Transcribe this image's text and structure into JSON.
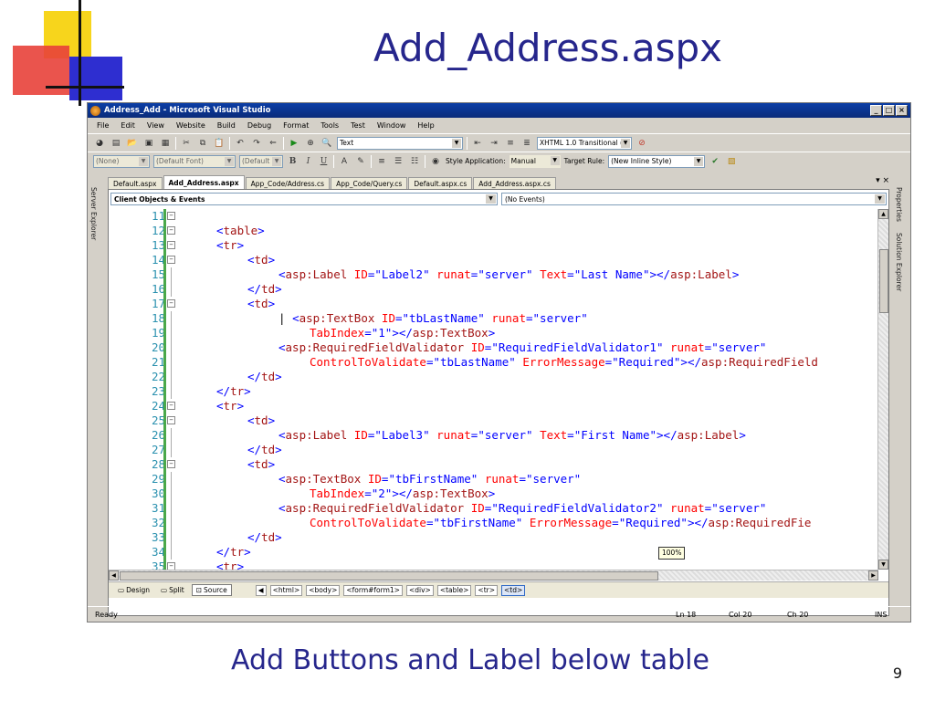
{
  "slide": {
    "title": "Add_Address.aspx",
    "subtitle": "Add Buttons and Label below table",
    "page_number": "9"
  },
  "window": {
    "title": "Address_Add - Microsoft Visual Studio",
    "controls": [
      "_",
      "□",
      "×"
    ]
  },
  "menu": [
    "File",
    "Edit",
    "View",
    "Website",
    "Build",
    "Debug",
    "Format",
    "Tools",
    "Test",
    "Window",
    "Help"
  ],
  "toolbar1": {
    "find_combo": "Text",
    "doctype_combo": "XHTML 1.0 Transitional ("
  },
  "toolbar2": {
    "block_format": "(None)",
    "font_name": "(Default Font)",
    "font_size": "(Default",
    "bold": "B",
    "italic": "I",
    "underline": "U",
    "style_application_label": "Style Application:",
    "style_application_value": "Manual",
    "target_rule_label": "Target Rule:",
    "target_rule_value": "(New Inline Style)"
  },
  "side_left": {
    "server_explorer": "Server Explorer"
  },
  "side_right": {
    "properties": "Properties",
    "solution_explorer": "Solution Explorer"
  },
  "doc_tabs": [
    "Default.aspx",
    "Add_Address.aspx",
    "App_Code/Address.cs",
    "App_Code/Query.cs",
    "Default.aspx.cs",
    "Add_Address.aspx.cs"
  ],
  "active_doc_tab": "Add_Address.aspx",
  "doc_tab_controls": "▾ ×",
  "nav": {
    "objects": "Client Objects & Events",
    "events": "(No Events)"
  },
  "code_lines": [
    {
      "n": "11",
      "indent": 0,
      "tokens": []
    },
    {
      "n": "12",
      "indent": 0,
      "tokens": [
        [
          "br",
          "<"
        ],
        [
          "tag",
          "table"
        ],
        [
          "br",
          ">"
        ]
      ]
    },
    {
      "n": "13",
      "indent": 0,
      "tokens": [
        [
          "br",
          "<"
        ],
        [
          "tag",
          "tr"
        ],
        [
          "br",
          ">"
        ]
      ]
    },
    {
      "n": "14",
      "indent": 1,
      "tokens": [
        [
          "br",
          "<"
        ],
        [
          "tag",
          "td"
        ],
        [
          "br",
          ">"
        ]
      ]
    },
    {
      "n": "15",
      "indent": 2,
      "tokens": [
        [
          "br",
          "<"
        ],
        [
          "tag",
          "asp:Label"
        ],
        [
          "t",
          " "
        ],
        [
          "attr",
          "ID"
        ],
        [
          "br",
          "="
        ],
        [
          "val",
          "\"Label2\""
        ],
        [
          "t",
          " "
        ],
        [
          "attr",
          "runat"
        ],
        [
          "br",
          "="
        ],
        [
          "val",
          "\"server\""
        ],
        [
          "t",
          " "
        ],
        [
          "attr",
          "Text"
        ],
        [
          "br",
          "="
        ],
        [
          "val",
          "\"Last Name\""
        ],
        [
          "br",
          "></"
        ],
        [
          "tag",
          "asp:Label"
        ],
        [
          "br",
          ">"
        ]
      ]
    },
    {
      "n": "16",
      "indent": 1,
      "tokens": [
        [
          "br",
          "</"
        ],
        [
          "tag",
          "td"
        ],
        [
          "br",
          ">"
        ]
      ]
    },
    {
      "n": "17",
      "indent": 1,
      "tokens": [
        [
          "br",
          "<"
        ],
        [
          "tag",
          "td"
        ],
        [
          "br",
          ">"
        ]
      ]
    },
    {
      "n": "18",
      "indent": 2,
      "tokens": [
        [
          "cur",
          "| "
        ],
        [
          "br",
          "<"
        ],
        [
          "tag",
          "asp:TextBox"
        ],
        [
          "t",
          " "
        ],
        [
          "attr",
          "ID"
        ],
        [
          "br",
          "="
        ],
        [
          "val",
          "\"tbLastName\""
        ],
        [
          "t",
          " "
        ],
        [
          "attr",
          "runat"
        ],
        [
          "br",
          "="
        ],
        [
          "val",
          "\"server\""
        ]
      ]
    },
    {
      "n": "19",
      "indent": 3,
      "tokens": [
        [
          "attr",
          "TabIndex"
        ],
        [
          "br",
          "="
        ],
        [
          "val",
          "\"1\""
        ],
        [
          "br",
          "></"
        ],
        [
          "tag",
          "asp:TextBox"
        ],
        [
          "br",
          ">"
        ]
      ]
    },
    {
      "n": "20",
      "indent": 2,
      "tokens": [
        [
          "br",
          "<"
        ],
        [
          "tag",
          "asp:RequiredFieldValidator"
        ],
        [
          "t",
          " "
        ],
        [
          "attr",
          "ID"
        ],
        [
          "br",
          "="
        ],
        [
          "val",
          "\"RequiredFieldValidator1\""
        ],
        [
          "t",
          " "
        ],
        [
          "attr",
          "runat"
        ],
        [
          "br",
          "="
        ],
        [
          "val",
          "\"server\""
        ]
      ]
    },
    {
      "n": "21",
      "indent": 3,
      "tokens": [
        [
          "attr",
          "ControlToValidate"
        ],
        [
          "br",
          "="
        ],
        [
          "val",
          "\"tbLastName\""
        ],
        [
          "t",
          " "
        ],
        [
          "attr",
          "ErrorMessage"
        ],
        [
          "br",
          "="
        ],
        [
          "val",
          "\"Required\""
        ],
        [
          "br",
          "></"
        ],
        [
          "tag",
          "asp:RequiredField"
        ]
      ]
    },
    {
      "n": "22",
      "indent": 1,
      "tokens": [
        [
          "br",
          "</"
        ],
        [
          "tag",
          "td"
        ],
        [
          "br",
          ">"
        ]
      ]
    },
    {
      "n": "23",
      "indent": 0,
      "tokens": [
        [
          "br",
          "</"
        ],
        [
          "tag",
          "tr"
        ],
        [
          "br",
          ">"
        ]
      ]
    },
    {
      "n": "24",
      "indent": 0,
      "tokens": [
        [
          "br",
          "<"
        ],
        [
          "tag",
          "tr"
        ],
        [
          "br",
          ">"
        ]
      ]
    },
    {
      "n": "25",
      "indent": 1,
      "tokens": [
        [
          "br",
          "<"
        ],
        [
          "tag",
          "td"
        ],
        [
          "br",
          ">"
        ]
      ]
    },
    {
      "n": "26",
      "indent": 2,
      "tokens": [
        [
          "br",
          "<"
        ],
        [
          "tag",
          "asp:Label"
        ],
        [
          "t",
          " "
        ],
        [
          "attr",
          "ID"
        ],
        [
          "br",
          "="
        ],
        [
          "val",
          "\"Label3\""
        ],
        [
          "t",
          " "
        ],
        [
          "attr",
          "runat"
        ],
        [
          "br",
          "="
        ],
        [
          "val",
          "\"server\""
        ],
        [
          "t",
          " "
        ],
        [
          "attr",
          "Text"
        ],
        [
          "br",
          "="
        ],
        [
          "val",
          "\"First Name\""
        ],
        [
          "br",
          "></"
        ],
        [
          "tag",
          "asp:Label"
        ],
        [
          "br",
          ">"
        ]
      ]
    },
    {
      "n": "27",
      "indent": 1,
      "tokens": [
        [
          "br",
          "</"
        ],
        [
          "tag",
          "td"
        ],
        [
          "br",
          ">"
        ]
      ]
    },
    {
      "n": "28",
      "indent": 1,
      "tokens": [
        [
          "br",
          "<"
        ],
        [
          "tag",
          "td"
        ],
        [
          "br",
          ">"
        ]
      ]
    },
    {
      "n": "29",
      "indent": 2,
      "tokens": [
        [
          "br",
          "<"
        ],
        [
          "tag",
          "asp:TextBox"
        ],
        [
          "t",
          " "
        ],
        [
          "attr",
          "ID"
        ],
        [
          "br",
          "="
        ],
        [
          "val",
          "\"tbFirstName\""
        ],
        [
          "t",
          " "
        ],
        [
          "attr",
          "runat"
        ],
        [
          "br",
          "="
        ],
        [
          "val",
          "\"server\""
        ]
      ]
    },
    {
      "n": "30",
      "indent": 3,
      "tokens": [
        [
          "attr",
          "TabIndex"
        ],
        [
          "br",
          "="
        ],
        [
          "val",
          "\"2\""
        ],
        [
          "br",
          "></"
        ],
        [
          "tag",
          "asp:TextBox"
        ],
        [
          "br",
          ">"
        ]
      ]
    },
    {
      "n": "31",
      "indent": 2,
      "tokens": [
        [
          "br",
          "<"
        ],
        [
          "tag",
          "asp:RequiredFieldValidator"
        ],
        [
          "t",
          " "
        ],
        [
          "attr",
          "ID"
        ],
        [
          "br",
          "="
        ],
        [
          "val",
          "\"RequiredFieldValidator2\""
        ],
        [
          "t",
          " "
        ],
        [
          "attr",
          "runat"
        ],
        [
          "br",
          "="
        ],
        [
          "val",
          "\"server\""
        ]
      ]
    },
    {
      "n": "32",
      "indent": 3,
      "tokens": [
        [
          "attr",
          "ControlToValidate"
        ],
        [
          "br",
          "="
        ],
        [
          "val",
          "\"tbFirstName\""
        ],
        [
          "t",
          " "
        ],
        [
          "attr",
          "ErrorMessage"
        ],
        [
          "br",
          "="
        ],
        [
          "val",
          "\"Required\""
        ],
        [
          "br",
          "></"
        ],
        [
          "tag",
          "asp:RequiredFie"
        ]
      ]
    },
    {
      "n": "33",
      "indent": 1,
      "tokens": [
        [
          "br",
          "</"
        ],
        [
          "tag",
          "td"
        ],
        [
          "br",
          ">"
        ]
      ]
    },
    {
      "n": "34",
      "indent": 0,
      "tokens": [
        [
          "br",
          "</"
        ],
        [
          "tag",
          "tr"
        ],
        [
          "br",
          ">"
        ]
      ]
    },
    {
      "n": "35",
      "indent": 0,
      "tokens": [
        [
          "br",
          "<"
        ],
        [
          "tag",
          "tr"
        ],
        [
          "br",
          ">"
        ]
      ]
    }
  ],
  "zoom_tooltip": "100%",
  "view_buttons": [
    "Design",
    "Split",
    "Source"
  ],
  "active_view": "Source",
  "breadcrumbs": [
    "<html>",
    "<body>",
    "<form#form1>",
    "<div>",
    "<table>",
    "<tr>",
    "<td>"
  ],
  "active_breadcrumb": "<td>",
  "status": {
    "text": "Ready",
    "line": "Ln 18",
    "col": "Col 20",
    "ch": "Ch 20",
    "mode": "INS"
  }
}
